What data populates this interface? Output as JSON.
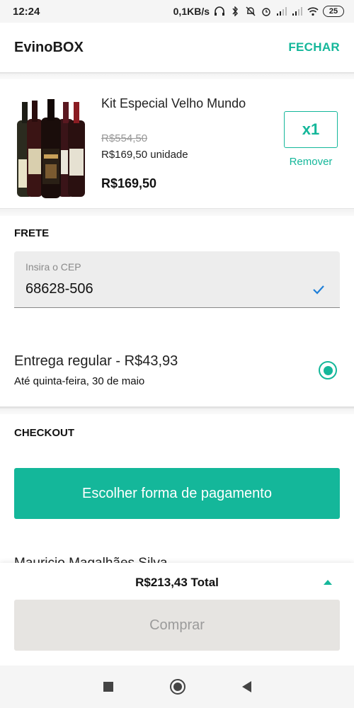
{
  "status_bar": {
    "time": "12:24",
    "network_speed": "0,1KB/s",
    "battery": "25",
    "icons": [
      "headphones-icon",
      "bluetooth-icon",
      "mute-icon",
      "alarm-icon",
      "signal-icon",
      "signal-icon",
      "wifi-icon",
      "battery-icon"
    ]
  },
  "header": {
    "title": "EvinoBOX",
    "close_label": "FECHAR"
  },
  "product": {
    "name": "Kit Especial Velho Mundo",
    "old_price": "R$554,50",
    "unit_price": "R$169,50 unidade",
    "total_price": "R$169,50",
    "quantity": "x1",
    "remove_label": "Remover"
  },
  "frete": {
    "title": "FRETE",
    "cep_placeholder": "Insira o CEP",
    "cep_value": "68628-506",
    "delivery_option": "Entrega regular - R$43,93",
    "delivery_date": "Até quinta-feira, 30 de maio"
  },
  "checkout": {
    "title": "CHECKOUT",
    "payment_button": "Escolher forma de pagamento",
    "peek_text": "Mauricio Magalhães Silva"
  },
  "footer": {
    "total": "R$213,43 Total",
    "buy_button": "Comprar"
  },
  "colors": {
    "accent": "#14b79a",
    "disabled_button": "#e6e4e1"
  }
}
